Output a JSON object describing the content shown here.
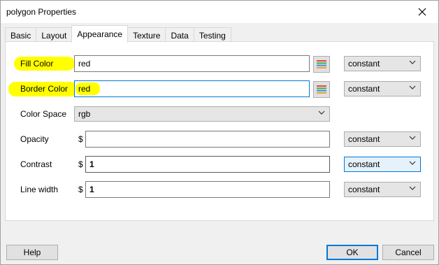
{
  "window": {
    "title": "polygon Properties"
  },
  "tabs": [
    "Basic",
    "Layout",
    "Appearance",
    "Texture",
    "Data",
    "Testing"
  ],
  "active_tab": "Appearance",
  "fields": {
    "fill_color": {
      "label": "Fill Color",
      "value": "red",
      "mode": "constant"
    },
    "border_color": {
      "label": "Border Color",
      "value": "red",
      "mode": "constant"
    },
    "color_space": {
      "label": "Color Space",
      "value": "rgb"
    },
    "opacity": {
      "label": "Opacity",
      "prefix": "$",
      "value": "",
      "mode": "constant"
    },
    "contrast": {
      "label": "Contrast",
      "prefix": "$",
      "value": "1",
      "mode": "constant"
    },
    "line_width": {
      "label": "Line width",
      "prefix": "$",
      "value": "1",
      "mode": "constant"
    }
  },
  "buttons": {
    "help": "Help",
    "ok": "OK",
    "cancel": "Cancel"
  },
  "colors": {
    "highlight": "#ffff00",
    "accent": "#0078d7"
  },
  "icons": {
    "close": "close-icon",
    "palette": "palette-icon",
    "chevron": "chevron-down-icon"
  }
}
